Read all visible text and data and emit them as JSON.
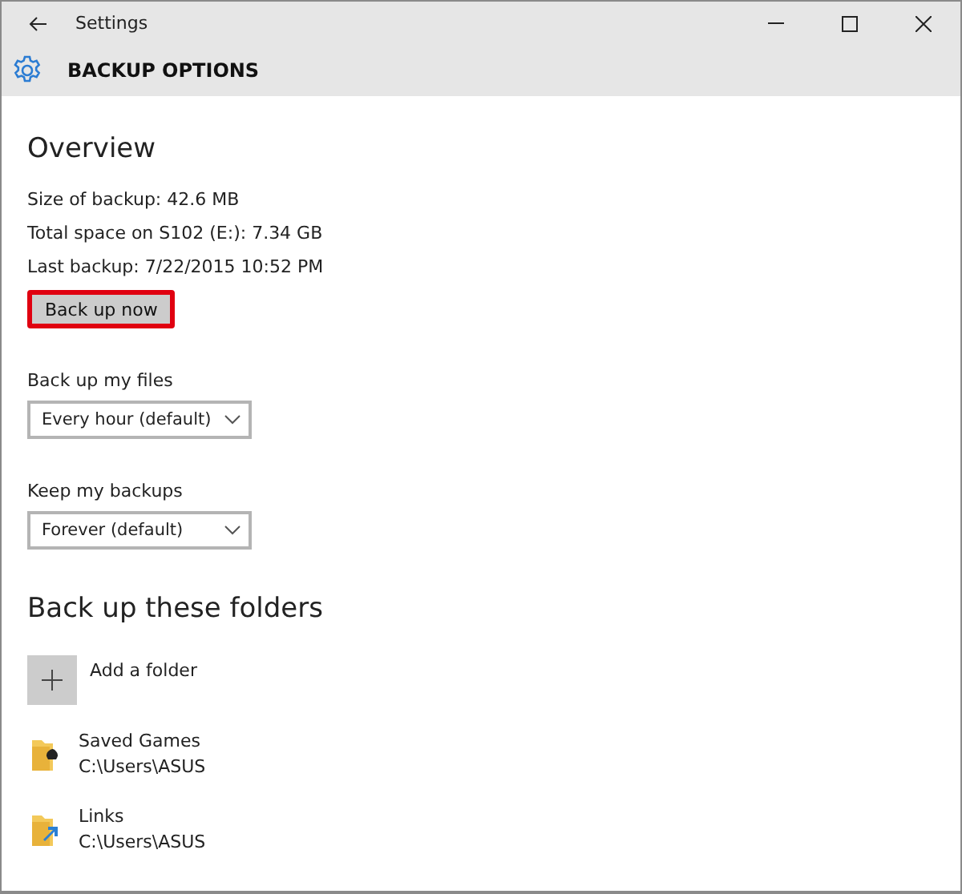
{
  "window": {
    "title": "Settings"
  },
  "header": {
    "title": "BACKUP OPTIONS"
  },
  "overview": {
    "heading": "Overview",
    "lines": [
      "Size of backup: 42.6 MB",
      "Total space on S102 (E:): 7.34 GB",
      "Last backup: 7/22/2015 10:52 PM"
    ],
    "button": {
      "label": "Back up now",
      "highlighted": true
    }
  },
  "settings": [
    {
      "label": "Back up my files",
      "value": "Every hour (default)"
    },
    {
      "label": "Keep my backups",
      "value": "Forever (default)"
    }
  ],
  "folders": {
    "heading": "Back up these folders",
    "add_label": "Add a folder",
    "items": [
      {
        "kind": "games",
        "name": "Saved Games",
        "path": "C:\\Users\\ASUS"
      },
      {
        "kind": "links",
        "name": "Links",
        "path": "C:\\Users\\ASUS"
      }
    ]
  }
}
